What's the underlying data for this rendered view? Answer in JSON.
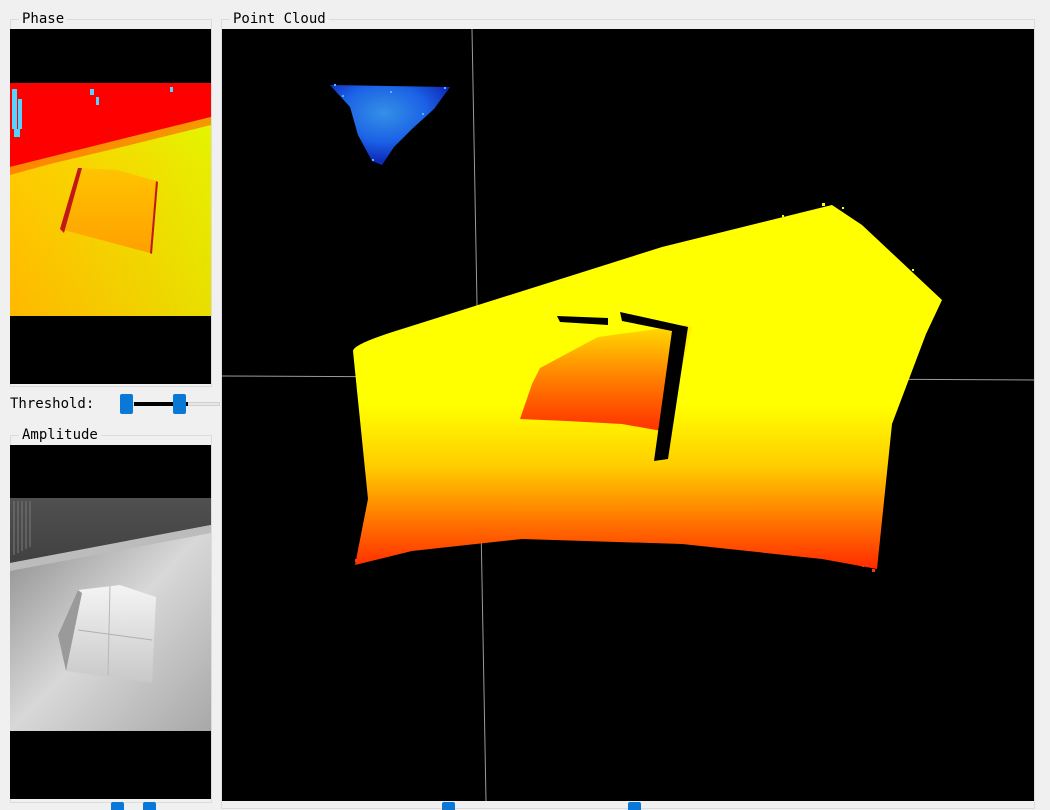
{
  "phase_panel": {
    "title": "Phase"
  },
  "threshold": {
    "label": "Threshold:",
    "low": 0.04,
    "high": 0.6
  },
  "amplitude_panel": {
    "title": "Amplitude"
  },
  "point_cloud_panel": {
    "title": "Point Cloud"
  }
}
